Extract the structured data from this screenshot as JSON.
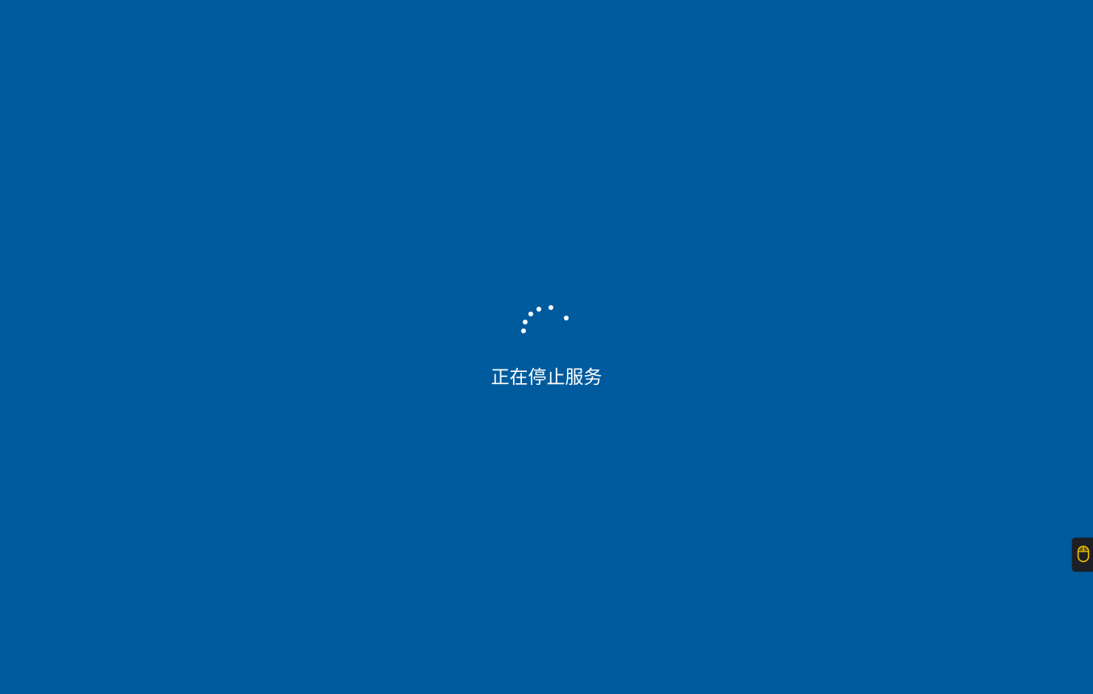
{
  "screen": {
    "background_color": "#005a9e",
    "status_text": "正在停止服务",
    "spinner_icon": "loading-dots-spinner"
  },
  "side_widget": {
    "icon": "mouse-icon",
    "icon_color": "#f3c300",
    "background_color": "#1d1f24"
  }
}
